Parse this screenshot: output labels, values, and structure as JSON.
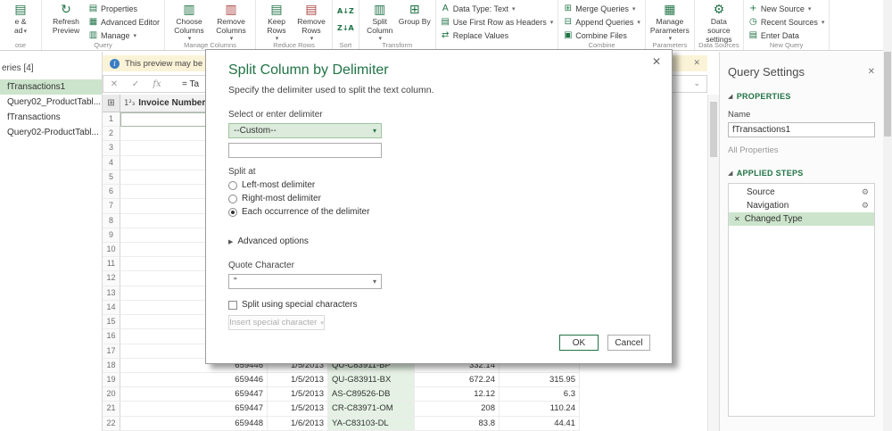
{
  "ribbon": {
    "close_partial_1": "e &",
    "close_partial_2": "ad",
    "refresh": "Refresh Preview",
    "properties": "Properties",
    "advanced_editor": "Advanced Editor",
    "manage": "Manage",
    "choose_columns": "Choose Columns",
    "remove_columns": "Remove Columns",
    "keep_rows": "Keep Rows",
    "remove_rows": "Remove Rows",
    "split_column": "Split Column",
    "group_by": "Group By",
    "data_type": "Data Type: Text",
    "use_first_row": "Use First Row as Headers",
    "replace_values": "Replace Values",
    "merge_queries": "Merge Queries",
    "append_queries": "Append Queries",
    "combine_files": "Combine Files",
    "manage_parameters": "Manage Parameters",
    "data_source_settings": "Data source settings",
    "new_source": "New Source",
    "recent_sources": "Recent Sources",
    "enter_data": "Enter Data",
    "labels": {
      "close": "ose",
      "query": "Query",
      "manage_columns": "Manage Columns",
      "reduce_rows": "Reduce Rows",
      "sort": "Sort",
      "transform": "Transform",
      "combine": "Combine",
      "parameters": "Parameters",
      "data_sources": "Data Sources",
      "new_query": "New Query"
    }
  },
  "queries_pane": {
    "header": "eries [4]",
    "items": [
      {
        "label": "fTransactions1",
        "selected": true
      },
      {
        "label": "Query02_ProductTabl...",
        "selected": false
      },
      {
        "label": "fTransactions",
        "selected": false
      },
      {
        "label": "Query02-ProductTabl...",
        "selected": false
      }
    ]
  },
  "info_bar": {
    "text": "This preview may be"
  },
  "formula_bar": {
    "value": "= Ta"
  },
  "grid": {
    "type_icon": "1²₃",
    "header": "Invoice Number",
    "rows": [
      {
        "n": "1",
        "invoice": "",
        "date": "",
        "code": "",
        "v1": "",
        "v2": ""
      },
      {
        "n": "2",
        "invoice": "",
        "date": "",
        "code": "",
        "v1": "",
        "v2": ""
      },
      {
        "n": "3",
        "invoice": "",
        "date": "",
        "code": "",
        "v1": "",
        "v2": ""
      },
      {
        "n": "4",
        "invoice": "",
        "date": "",
        "code": "",
        "v1": "",
        "v2": ""
      },
      {
        "n": "5",
        "invoice": "",
        "date": "",
        "code": "",
        "v1": "",
        "v2": ""
      },
      {
        "n": "6",
        "invoice": "",
        "date": "",
        "code": "",
        "v1": "",
        "v2": ""
      },
      {
        "n": "7",
        "invoice": "",
        "date": "",
        "code": "",
        "v1": "",
        "v2": ""
      },
      {
        "n": "8",
        "invoice": "",
        "date": "",
        "code": "",
        "v1": "",
        "v2": ""
      },
      {
        "n": "9",
        "invoice": "",
        "date": "",
        "code": "",
        "v1": "",
        "v2": ""
      },
      {
        "n": "10",
        "invoice": "",
        "date": "",
        "code": "",
        "v1": "",
        "v2": ""
      },
      {
        "n": "11",
        "invoice": "",
        "date": "",
        "code": "",
        "v1": "",
        "v2": ""
      },
      {
        "n": "12",
        "invoice": "",
        "date": "",
        "code": "",
        "v1": "",
        "v2": ""
      },
      {
        "n": "13",
        "invoice": "",
        "date": "",
        "code": "",
        "v1": "",
        "v2": ""
      },
      {
        "n": "14",
        "invoice": "",
        "date": "",
        "code": "",
        "v1": "",
        "v2": ""
      },
      {
        "n": "15",
        "invoice": "",
        "date": "",
        "code": "",
        "v1": "",
        "v2": ""
      },
      {
        "n": "16",
        "invoice": "",
        "date": "",
        "code": "",
        "v1": "",
        "v2": ""
      },
      {
        "n": "17",
        "invoice": "",
        "date": "",
        "code": "",
        "v1": "",
        "v2": ""
      },
      {
        "n": "18",
        "invoice": "659446",
        "date": "1/5/2013",
        "code": "QU-C83911-BP",
        "v1": "332.14",
        "v2": ""
      },
      {
        "n": "19",
        "invoice": "659446",
        "date": "1/5/2013",
        "code": "QU-G83911-BX",
        "v1": "672.24",
        "v2": "315.95"
      },
      {
        "n": "20",
        "invoice": "659447",
        "date": "1/5/2013",
        "code": "AS-C89526-DB",
        "v1": "12.12",
        "v2": "6.3"
      },
      {
        "n": "21",
        "invoice": "659447",
        "date": "1/5/2013",
        "code": "CR-C83971-OM",
        "v1": "208",
        "v2": "110.24"
      },
      {
        "n": "22",
        "invoice": "659448",
        "date": "1/6/2013",
        "code": "YA-C83103-DL",
        "v1": "83.8",
        "v2": "44.41"
      }
    ]
  },
  "dialog": {
    "title": "Split Column by Delimiter",
    "subtitle": "Specify the delimiter used to split the text column.",
    "delimiter_label": "Select or enter delimiter",
    "delimiter_value": "--Custom--",
    "custom_value": "",
    "split_at_label": "Split at",
    "radio_left": "Left-most delimiter",
    "radio_right": "Right-most delimiter",
    "radio_each": "Each occurrence of the delimiter",
    "advanced_label": "Advanced options",
    "quote_label": "Quote Character",
    "quote_value": "\"",
    "special_chars_label": "Split using special characters",
    "insert_special_label": "Insert special character",
    "ok": "OK",
    "cancel": "Cancel"
  },
  "query_settings": {
    "title": "Query Settings",
    "properties_header": "PROPERTIES",
    "name_label": "Name",
    "name_value": "fTransactions1",
    "all_properties": "All Properties",
    "steps_header": "APPLIED STEPS",
    "steps": [
      {
        "label": "Source",
        "selected": false
      },
      {
        "label": "Navigation",
        "selected": false
      },
      {
        "label": "Changed Type",
        "selected": true
      }
    ]
  }
}
